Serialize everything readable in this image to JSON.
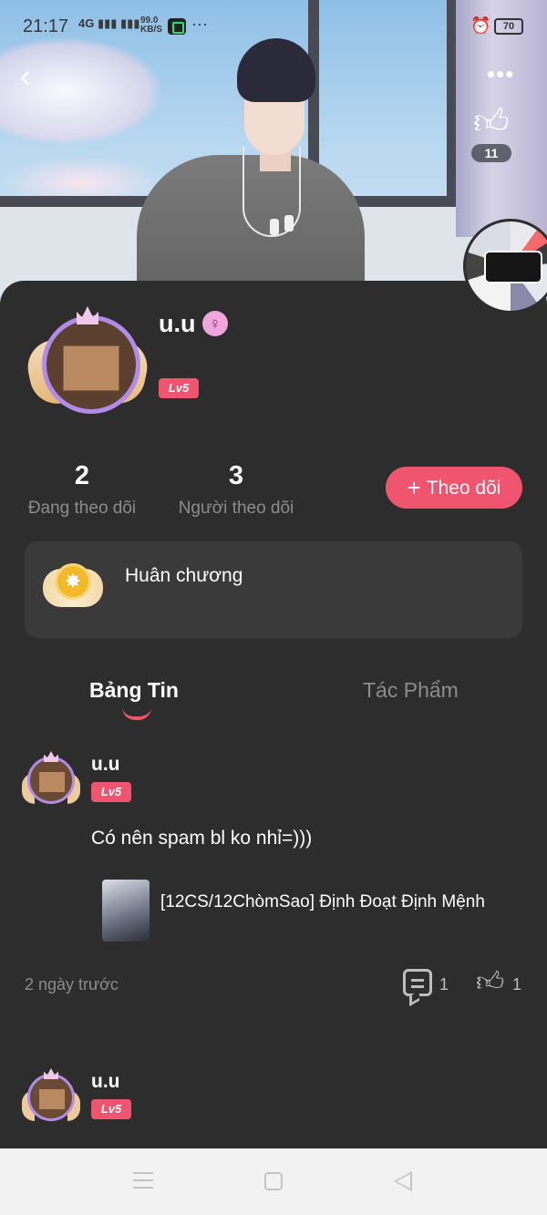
{
  "status_bar": {
    "time": "21:17",
    "network": "4G",
    "speed": "99.0",
    "speed_unit": "KB/S",
    "more": "···",
    "battery": "70"
  },
  "header": {
    "back_icon": "chevron-left-icon",
    "more_icon": "more-dots-icon",
    "like_count": "11"
  },
  "profile": {
    "username": "u.u",
    "gender_icon": "female-icon",
    "level": "Lv5",
    "stats": [
      {
        "value": "2",
        "label": "Đang theo dõi"
      },
      {
        "value": "3",
        "label": "Người theo dõi"
      }
    ],
    "follow_label": "Theo dõi"
  },
  "medal": {
    "label": "Huân chương"
  },
  "tabs": [
    {
      "label": "Bảng Tin",
      "active": true
    },
    {
      "label": "Tác Phẩm",
      "active": false
    }
  ],
  "posts": [
    {
      "author": "u.u",
      "level": "Lv5",
      "text": "Có nên spam bl ko nhỉ=)))",
      "linked_work": "[12CS/12ChòmSao] Định Đoạt Định Mệnh",
      "time": "2 ngày trước",
      "comments": "1",
      "likes": "1"
    },
    {
      "author": "u.u",
      "level": "Lv5"
    }
  ],
  "colors": {
    "accent": "#f0556f",
    "background": "#2d2d2d",
    "card": "#3a3a3a",
    "muted_text": "#8c8c8c"
  }
}
